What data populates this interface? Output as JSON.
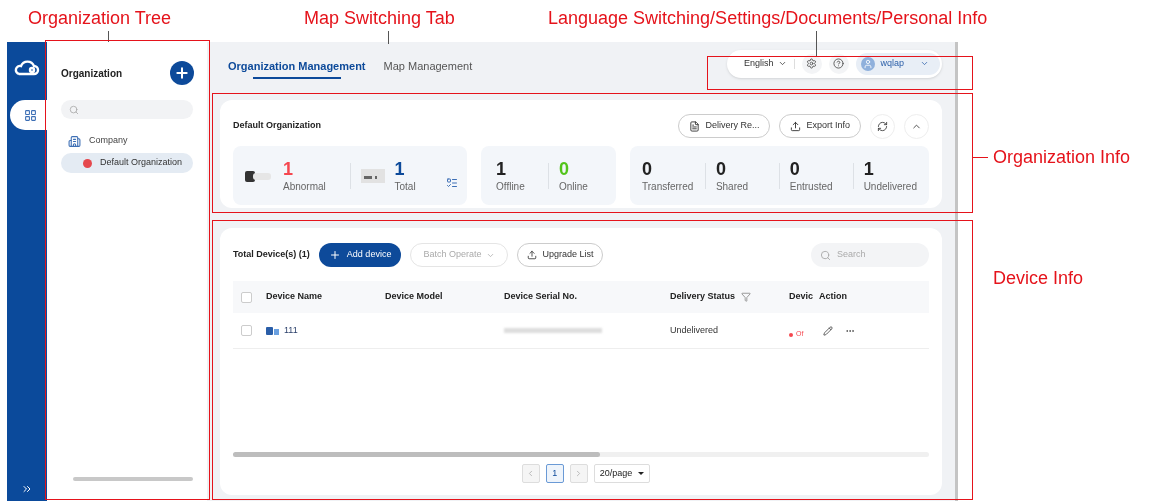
{
  "annotations": {
    "top_labels": [
      "Organization Tree",
      "Map Switching Tab",
      "Language Switching/Settings/Documents/Personal Info"
    ],
    "side_labels": [
      "Organization Info",
      "Device Info"
    ]
  },
  "tree": {
    "title": "Organization",
    "items": [
      {
        "label": "Company",
        "selected": false,
        "alert": false,
        "children": [
          {
            "label": "Default Organization",
            "selected": true,
            "alert": true
          }
        ]
      }
    ]
  },
  "tabs": [
    {
      "label": "Organization Management",
      "selected": true
    },
    {
      "label": "Map Management",
      "selected": false
    }
  ],
  "header": {
    "language": "English",
    "user": "wqlap"
  },
  "organization": {
    "title": "Default Organization",
    "buttons": [
      "Delivery Re...",
      "Export Info"
    ],
    "stat_groups": [
      [
        {
          "kind": "camera",
          "value": "1",
          "label": "Abnormal",
          "color": "#f5474f"
        },
        {
          "kind": "recorder",
          "value": "1",
          "label": "Total",
          "color": "#0d4a9a"
        }
      ],
      [
        {
          "kind": "plain",
          "value": "1",
          "label": "Offline",
          "color": "#222222"
        },
        {
          "kind": "plain",
          "value": "0",
          "label": "Online",
          "color": "#52c41a"
        }
      ],
      [
        {
          "kind": "plain",
          "value": "0",
          "label": "Transferred",
          "color": "#222222"
        },
        {
          "kind": "plain",
          "value": "0",
          "label": "Shared",
          "color": "#222222"
        },
        {
          "kind": "plain",
          "value": "0",
          "label": "Entrusted",
          "color": "#222222"
        },
        {
          "kind": "plain",
          "value": "1",
          "label": "Undelivered",
          "color": "#222222"
        }
      ]
    ]
  },
  "devices": {
    "total": "Total Device(s) (1)",
    "add_button": "Add device",
    "batch_button": {
      "label": "Batch Operate",
      "disabled": true
    },
    "upgrade_button": "Upgrade List",
    "search": {
      "placeholder": "Search"
    },
    "select_all_checked": false,
    "columns": [
      "Device Name",
      "Device Model",
      "Device Serial No.",
      "Delivery Status",
      "Devic",
      "Action"
    ],
    "rows": [
      {
        "checked": false,
        "name": "111",
        "delivery": "Undelivered",
        "status": {
          "text": "Of",
          "color": "#f5474f"
        }
      }
    ],
    "pagination": {
      "pages": [
        {
          "label": "1",
          "selected": true
        }
      ],
      "page_size": "20/page"
    }
  }
}
